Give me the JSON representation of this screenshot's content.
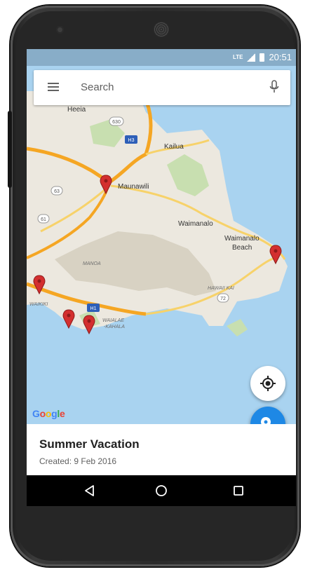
{
  "status_bar": {
    "network": "LTE",
    "time": "20:51"
  },
  "search": {
    "placeholder": "Search"
  },
  "map": {
    "labels": {
      "heeia": "Heeia",
      "kailua": "Kailua",
      "maunawili": "Maunawili",
      "waimanalo": "Waimanalo",
      "waimanalo_beach_1": "Waimanalo",
      "waimanalo_beach_2": "Beach",
      "manoa": "MANOA",
      "hawaii_kai": "HAWAII KAI",
      "waikiki": "WAIKIKI",
      "waialae_1": "WAIALAE",
      "waialae_2": "-KAHALA",
      "route_630": "630",
      "route_h3": "H3",
      "route_63": "63",
      "route_61": "61",
      "route_h1": "H1",
      "route_72": "72"
    },
    "marker_color": "#d32f2f",
    "water_color": "#a9d3f0",
    "land_color": "#ece8df"
  },
  "google_logo": {
    "g1": "G",
    "o1": "o",
    "o2": "o",
    "g2": "g",
    "l": "l",
    "e": "e"
  },
  "fab": {
    "my_location_icon": "my-location-icon",
    "add_place_icon": "add-location-icon",
    "accent": "#1e88e5"
  },
  "card": {
    "title": "Summer Vacation",
    "subtitle": "Created: 9 Feb 2016"
  },
  "navbar": {
    "back": "back-icon",
    "home": "home-icon",
    "recents": "recents-icon"
  }
}
